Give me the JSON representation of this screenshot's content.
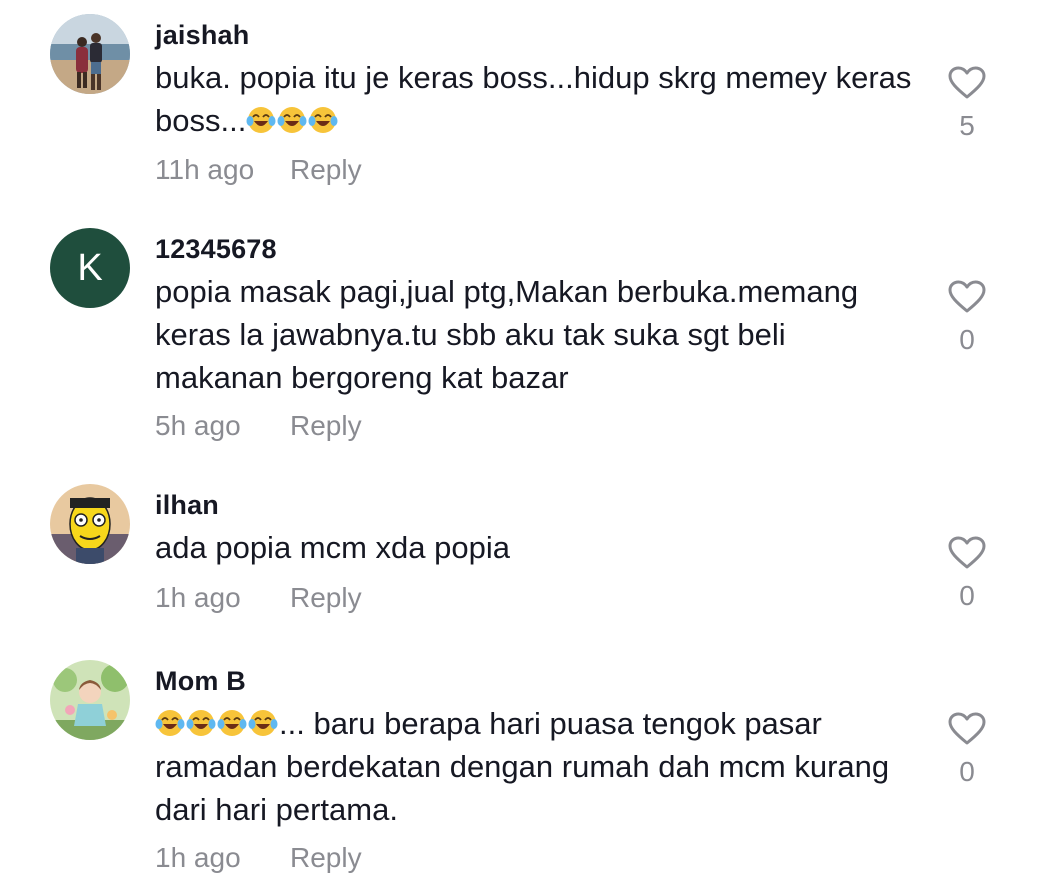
{
  "comments": [
    {
      "username": "jaishah",
      "text": "buka. popia itu je keras boss...hidup skrg memey keras boss...",
      "emoji_count": 3,
      "emoji": "face-with-tears-of-joy",
      "time": "11h ago",
      "reply_label": "Reply",
      "likes": "5",
      "avatar": "photo-couple-beach"
    },
    {
      "username": "12345678",
      "text": "popia masak pagi,jual ptg,Makan berbuka.memang keras la jawabnya.tu sbb aku tak suka sgt beli makanan bergoreng kat bazar",
      "time": "5h ago",
      "reply_label": "Reply",
      "likes": "0",
      "avatar_letter": "K",
      "avatar_color": "#1f4e3d"
    },
    {
      "username": "ilhan",
      "text": "ada popia mcm xda popia",
      "time": "1h ago",
      "reply_label": "Reply",
      "likes": "0",
      "avatar": "cartoon-yellow-face"
    },
    {
      "username": "Mom B",
      "text_before": "",
      "emoji_count": 4,
      "emoji": "face-with-tears-of-joy",
      "text": "... baru berapa hari puasa tengok pasar ramadan berdekatan dengan rumah dah mcm kurang dari hari pertama.",
      "time": "1h ago",
      "reply_label": "Reply",
      "likes": "0",
      "avatar": "cartoon-girl-garden"
    }
  ],
  "colors": {
    "text": "#161823",
    "muted": "#8a8b91",
    "avatar_k": "#1f4e3d"
  },
  "icons": {
    "like": "heart-outline-icon",
    "emoji": "face-with-tears-of-joy"
  }
}
